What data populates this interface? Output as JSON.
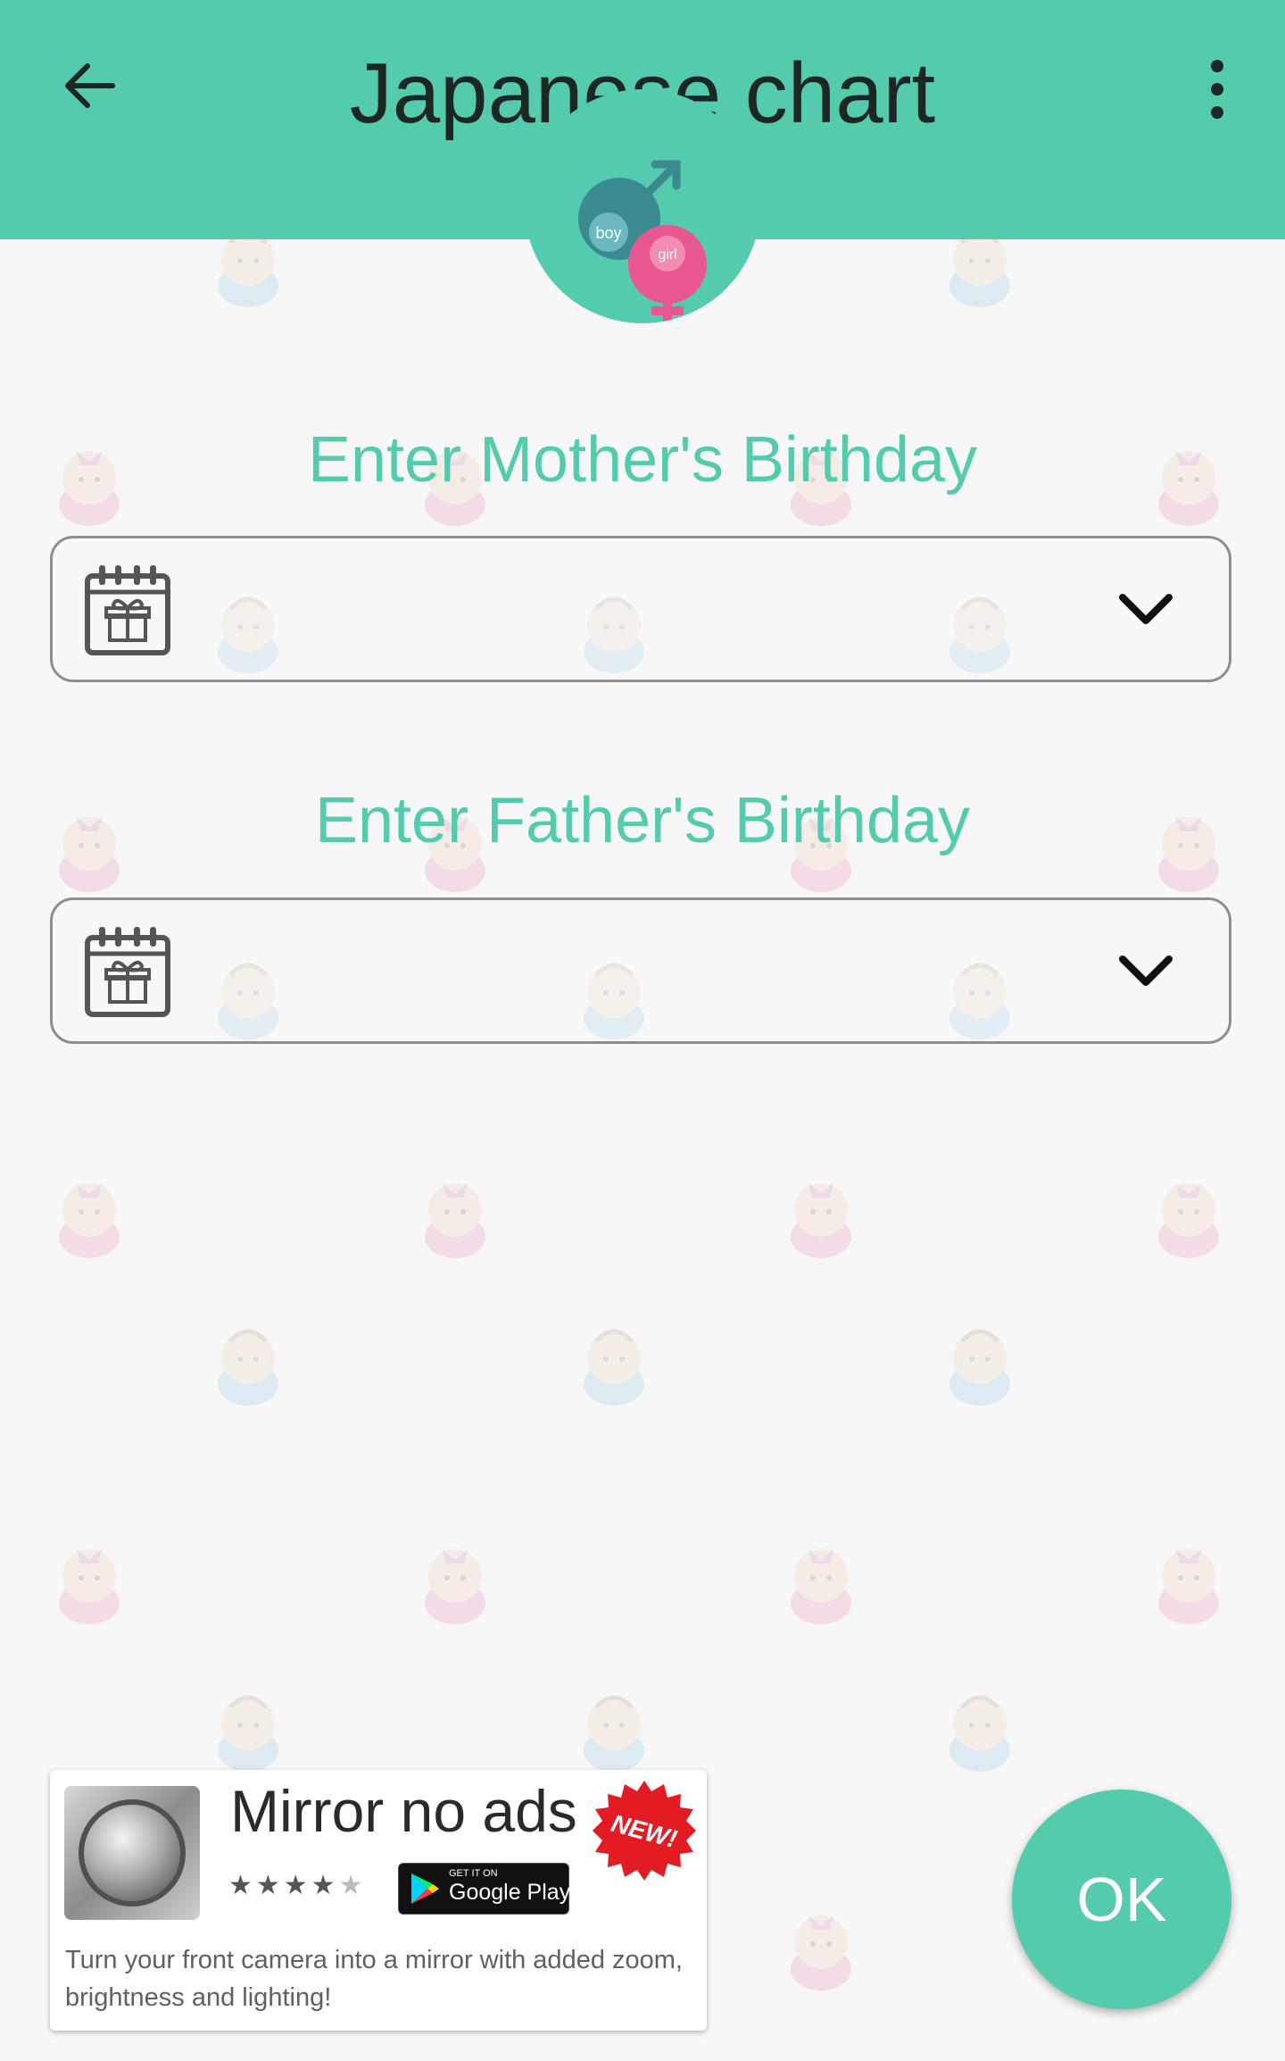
{
  "app_bar": {
    "title": "Japanese chart",
    "back_icon": "arrow-left-icon",
    "menu_icon": "more-vert-icon",
    "background_color": "#55cbad"
  },
  "logo": {
    "boy_label": "boy",
    "girl_label": "girl",
    "boy_color": "#3b8a91",
    "girl_color": "#e8578f"
  },
  "form": {
    "mother_label": "Enter Mother's Birthday",
    "father_label": "Enter Father's Birthday",
    "field_icon": "calendar-gift-icon",
    "dropdown_icon": "chevron-down-icon",
    "accent_color": "#55cbad"
  },
  "ad": {
    "title": "Mirror no ads",
    "badge": "NEW!",
    "rating_stars": "★★★★",
    "rating_star_empty": "★",
    "store_small": "GET IT ON",
    "store_name": "Google Play",
    "description": "Turn your front camera into a mirror with added zoom, brightness and lighting!"
  },
  "ok_button": {
    "label": "OK"
  }
}
